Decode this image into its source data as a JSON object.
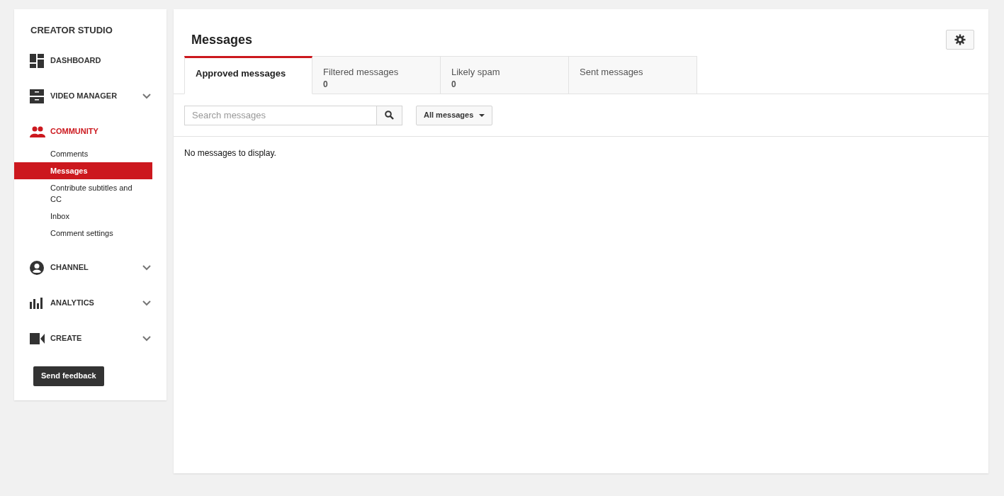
{
  "sidebar": {
    "title": "CREATOR STUDIO",
    "sections": [
      {
        "label": "DASHBOARD",
        "selected": false,
        "collapsible": false
      },
      {
        "label": "VIDEO MANAGER",
        "selected": false,
        "collapsible": true
      },
      {
        "label": "COMMUNITY",
        "selected": true,
        "collapsible": false,
        "children": [
          {
            "label": "Comments",
            "selected": false
          },
          {
            "label": "Messages",
            "selected": true
          },
          {
            "label": "Contribute subtitles and CC",
            "selected": false
          },
          {
            "label": "Inbox",
            "selected": false
          },
          {
            "label": "Comment settings",
            "selected": false
          }
        ]
      },
      {
        "label": "CHANNEL",
        "selected": false,
        "collapsible": true
      },
      {
        "label": "ANALYTICS",
        "selected": false,
        "collapsible": true
      },
      {
        "label": "CREATE",
        "selected": false,
        "collapsible": true
      }
    ],
    "feedback_button": "Send feedback"
  },
  "main": {
    "title": "Messages",
    "tabs": [
      {
        "label": "Approved messages",
        "selected": true
      },
      {
        "label": "Filtered messages",
        "count": "0",
        "selected": false
      },
      {
        "label": "Likely spam",
        "count": "0",
        "selected": false
      },
      {
        "label": "Sent messages",
        "selected": false
      }
    ],
    "search": {
      "placeholder": "Search messages"
    },
    "filter": "All messages",
    "empty_text": "No messages to display."
  }
}
